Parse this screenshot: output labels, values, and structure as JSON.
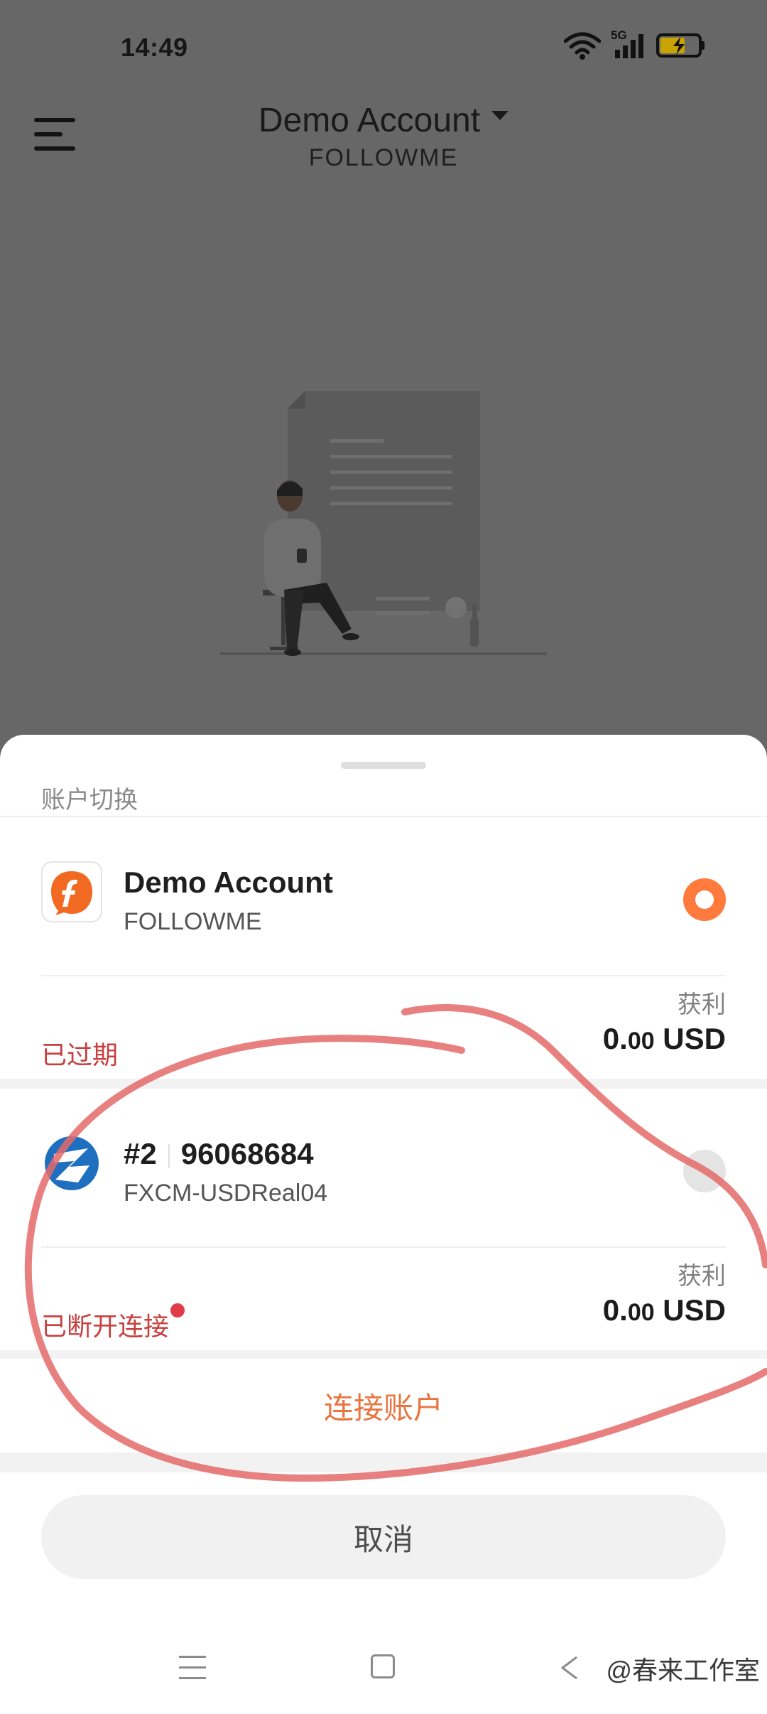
{
  "status_bar": {
    "time": "14:49",
    "network": "5G"
  },
  "header": {
    "title": "Demo Account",
    "subtitle": "FOLLOWME"
  },
  "sheet": {
    "title": "账户切换",
    "accounts": [
      {
        "name": "Demo Account",
        "sub": "FOLLOWME",
        "status": "已过期",
        "profit_label": "获利",
        "profit_int": "0.",
        "profit_dec": "00",
        "profit_unit": " USD",
        "selected": true
      },
      {
        "name_prefix": "#2",
        "name": "96068684",
        "sub": "FXCM-USDReal04",
        "status": "已断开连接",
        "profit_label": "获利",
        "profit_int": "0.",
        "profit_dec": "00",
        "profit_unit": " USD",
        "selected": false
      }
    ],
    "connect_label": "连接账户",
    "cancel_label": "取消"
  },
  "watermark": "@春来工作室",
  "colors": {
    "accent": "#ff7a3d",
    "status_red": "#c6403f",
    "dot_red": "#e23b4a",
    "connect_orange": "#e8743f"
  }
}
